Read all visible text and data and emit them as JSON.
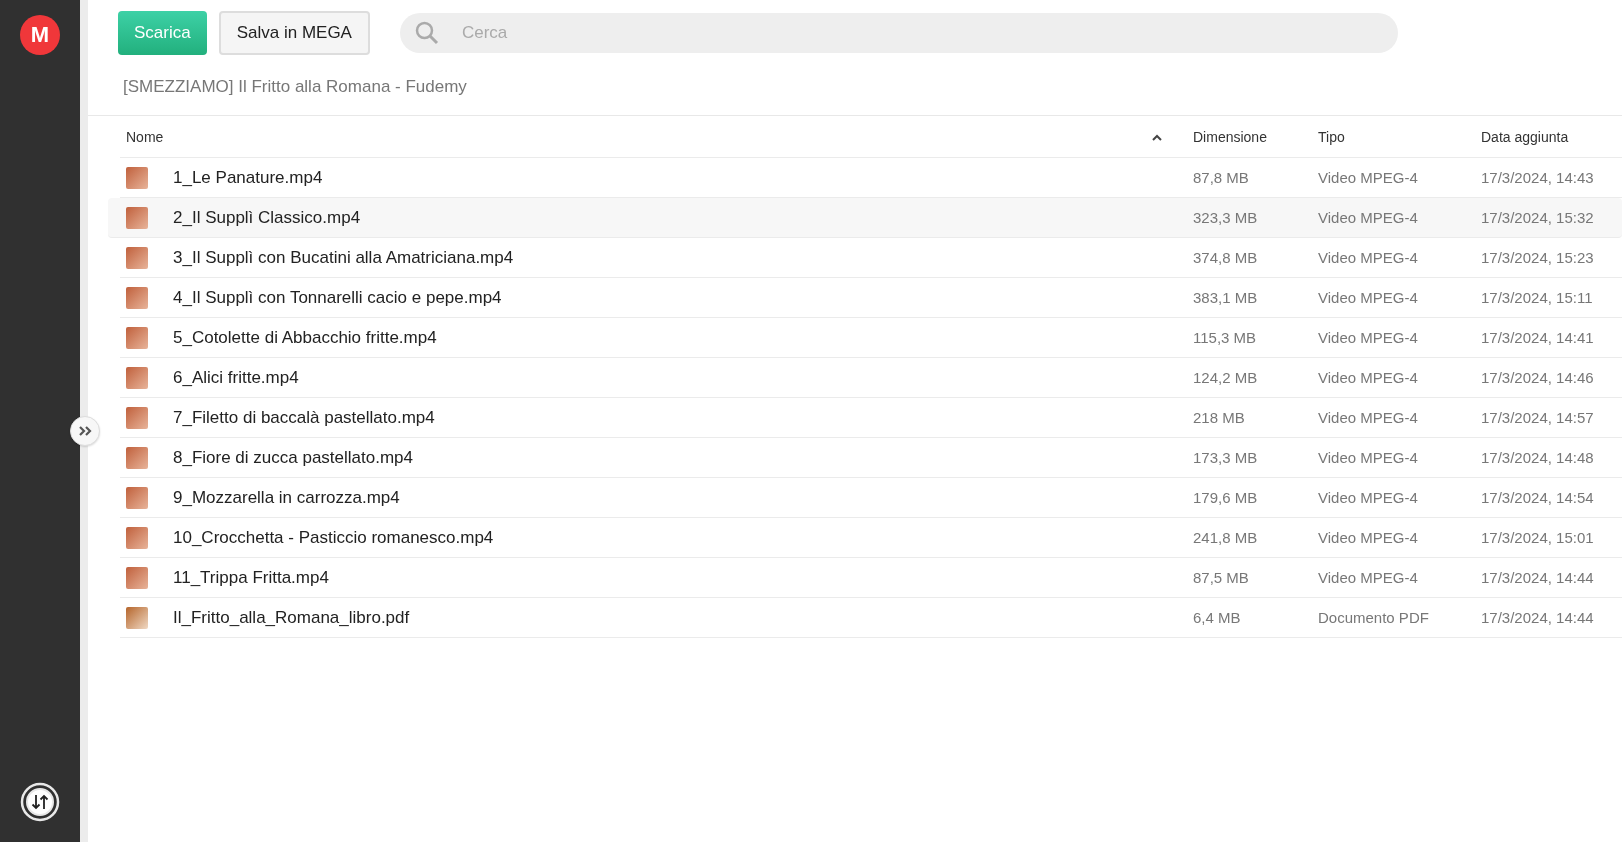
{
  "sidebar": {
    "logo": "M"
  },
  "toolbar": {
    "download_button": "Scarica",
    "save_button": "Salva in MEGA",
    "search": {
      "placeholder": "Cerca"
    }
  },
  "breadcrumb": "[SMEZZIAMO] Il Fritto alla Romana - Fudemy",
  "table": {
    "columns": [
      {
        "label": "Nome",
        "sorted": true
      },
      {
        "label": "Dimensione",
        "sorted": false
      },
      {
        "label": "Tipo",
        "sorted": false
      },
      {
        "label": "Data aggiunta",
        "sorted": false
      }
    ],
    "rows": [
      {
        "name": "1_Le Panature.mp4",
        "size": "87,8 MB",
        "type": "Video MPEG-4",
        "date": "17/3/2024, 14:43",
        "selected": false
      },
      {
        "name": "2_Il Supplì Classico.mp4",
        "size": "323,3 MB",
        "type": "Video MPEG-4",
        "date": "17/3/2024, 15:32",
        "selected": true
      },
      {
        "name": "3_Il Supplì con Bucatini alla Amatriciana.mp4",
        "size": "374,8 MB",
        "type": "Video MPEG-4",
        "date": "17/3/2024, 15:23",
        "selected": false
      },
      {
        "name": "4_Il Supplì con Tonnarelli cacio e pepe.mp4",
        "size": "383,1 MB",
        "type": "Video MPEG-4",
        "date": "17/3/2024, 15:11",
        "selected": false
      },
      {
        "name": "5_Cotolette di Abbacchio fritte.mp4",
        "size": "115,3 MB",
        "type": "Video MPEG-4",
        "date": "17/3/2024, 14:41",
        "selected": false
      },
      {
        "name": "6_Alici fritte.mp4",
        "size": "124,2 MB",
        "type": "Video MPEG-4",
        "date": "17/3/2024, 14:46",
        "selected": false
      },
      {
        "name": "7_Filetto di baccalà pastellato.mp4",
        "size": "218 MB",
        "type": "Video MPEG-4",
        "date": "17/3/2024, 14:57",
        "selected": false
      },
      {
        "name": "8_Fiore di zucca pastellato.mp4",
        "size": "173,3 MB",
        "type": "Video MPEG-4",
        "date": "17/3/2024, 14:48",
        "selected": false
      },
      {
        "name": "9_Mozzarella in carrozza.mp4",
        "size": "179,6 MB",
        "type": "Video MPEG-4",
        "date": "17/3/2024, 14:54",
        "selected": false
      },
      {
        "name": "10_Crocchetta - Pasticcio romanesco.mp4",
        "size": "241,8 MB",
        "type": "Video MPEG-4",
        "date": "17/3/2024, 15:01",
        "selected": false
      },
      {
        "name": "11_Trippa Fritta.mp4",
        "size": "87,5 MB",
        "type": "Video MPEG-4",
        "date": "17/3/2024, 14:44",
        "selected": false
      },
      {
        "name": "Il_Fritto_alla_Romana_libro.pdf",
        "size": "6,4 MB",
        "type": "Documento PDF",
        "date": "17/3/2024, 14:44",
        "selected": false
      }
    ]
  }
}
